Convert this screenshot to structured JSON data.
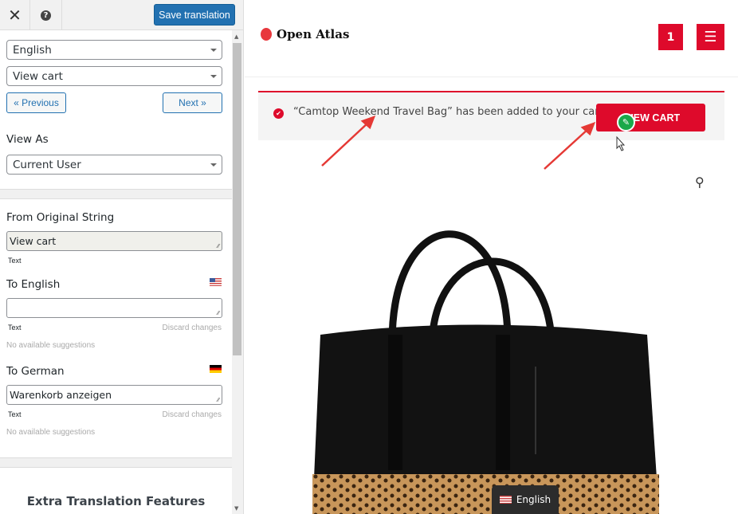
{
  "editor": {
    "close_icon": "close-icon",
    "help_icon": "help-icon",
    "save_label": "Save translation",
    "language": "English",
    "string": "View cart",
    "prev": "« Previous",
    "next": "Next »",
    "view_as_label": "View As",
    "view_as": "Current User",
    "from_label": "From Original String",
    "from_value": "View cart",
    "from_type": "Text",
    "to_english_label": "To English",
    "to_english_value": "",
    "english_type": "Text",
    "discard": "Discard changes",
    "no_sugg": "No available suggestions",
    "to_german_label": "To German",
    "to_german_value": "Warenkorb anzeigen",
    "german_type": "Text",
    "extra": "Extra Translation Features"
  },
  "site": {
    "logo": "Open Atlas",
    "cart_count": "1",
    "notice": "“Camtop Weekend Travel Bag” has been added to your cart.",
    "view_cart": "VIEW CART",
    "lang_switcher": "English"
  },
  "colors": {
    "brand_red": "#de0a2b",
    "wp_blue": "#2271b1",
    "edit_green": "#1aa84a"
  }
}
